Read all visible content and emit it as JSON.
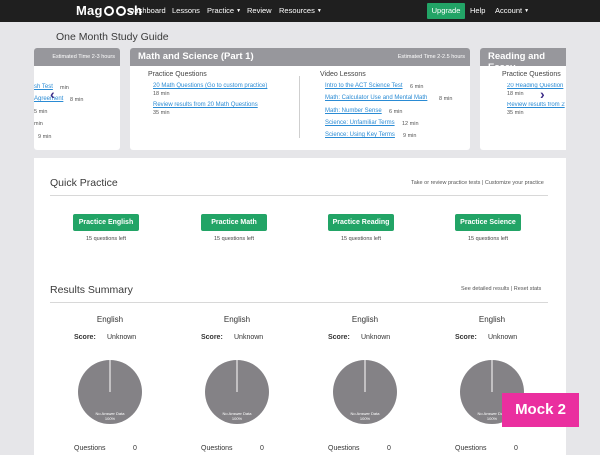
{
  "nav": {
    "logo_pre": "Mag",
    "logo_post": "sh",
    "items": [
      "Dashboard",
      "Lessons",
      "Practice",
      "Review",
      "Resources"
    ],
    "upgrade": "Upgrade",
    "help": "Help",
    "account": "Account"
  },
  "study_guide": {
    "title": "One Month Study Guide",
    "left_card": {
      "est": "Estimated Time 2-3 hours",
      "items": [
        {
          "text": "sh Test",
          "dur": "min"
        },
        {
          "text": "Agreement",
          "dur": "8 min"
        },
        {
          "text": "",
          "dur": "5 min"
        },
        {
          "text": "",
          "dur": "min"
        },
        {
          "text": "",
          "dur": "9 min"
        }
      ]
    },
    "main_card": {
      "title": "Math and Science (Part 1)",
      "est": "Estimated Time 2-2.5 hours",
      "practice_title": "Practice Questions",
      "practice": [
        {
          "text": "20 Math Questions (Go to custom practice)",
          "dur": "18 min"
        },
        {
          "text": "Review results from 20 Math Questions",
          "dur": "35 min"
        }
      ],
      "video_title": "Video Lessons",
      "videos": [
        {
          "text": "Intro to the ACT Science Test",
          "dur": "6 min"
        },
        {
          "text": "Math: Calculator Use and Mental Math",
          "dur": "8 min"
        },
        {
          "text": "Math: Number Sense",
          "dur": "6 min"
        },
        {
          "text": "Science: Unfamiliar Terms",
          "dur": "12 min"
        },
        {
          "text": "Science: Using Key Terms",
          "dur": "9 min"
        }
      ]
    },
    "right_card": {
      "title": "Reading and Essay",
      "practice_title": "Practice Questions",
      "practice": [
        {
          "text": "20 Reading Question",
          "dur": "18 min"
        },
        {
          "text": "Review results from 2",
          "dur": "35 min"
        }
      ]
    }
  },
  "quick_practice": {
    "title": "Quick Practice",
    "links": "Take or review practice tests | Customize your practice",
    "buttons": [
      {
        "label": "Practice English",
        "left": "15 questions left"
      },
      {
        "label": "Practice Math",
        "left": "15 questions left"
      },
      {
        "label": "Practice Reading",
        "left": "15 questions left"
      },
      {
        "label": "Practice Science",
        "left": "15 questions left"
      }
    ]
  },
  "results": {
    "title": "Results Summary",
    "links": "See detailed results | Reset stats",
    "score_label": "Score:",
    "questions_label": "Questions",
    "pie_label": "No Answer Data",
    "pie_pct": "100%",
    "cols": [
      {
        "subject": "English",
        "score": "Unknown",
        "questions": "0"
      },
      {
        "subject": "English",
        "score": "Unknown",
        "questions": "0"
      },
      {
        "subject": "English",
        "score": "Unknown",
        "questions": "0"
      },
      {
        "subject": "English",
        "score": "Unknown",
        "questions": "0"
      }
    ]
  },
  "badge": "Mock 2",
  "colors": {
    "accent": "#22a466",
    "nav_bg": "#1f1f1f",
    "card_head": "#97979c",
    "link": "#2a8bd4",
    "badge": "#ea2f9f"
  }
}
